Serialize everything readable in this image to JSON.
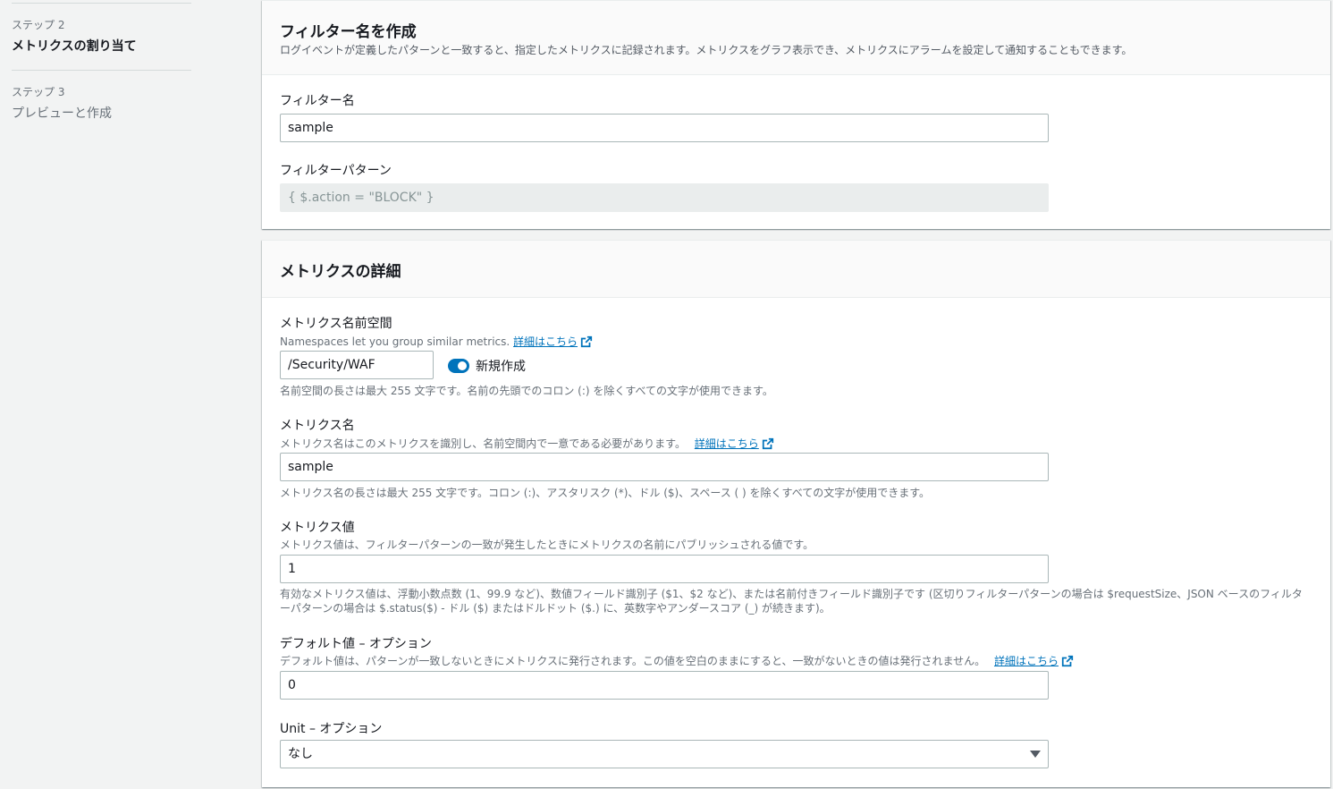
{
  "sidebar": {
    "steps": [
      {
        "label": "ステップ 2",
        "title": "メトリクスの割り当て"
      },
      {
        "label": "ステップ 3",
        "title": "プレビューと作成"
      }
    ]
  },
  "filter_panel": {
    "title": "フィルター名を作成",
    "description": "ログイベントが定義したパターンと一致すると、指定したメトリクスに記録されます。メトリクスをグラフ表示でき、メトリクスにアラームを設定して通知することもできます。",
    "filter_name_label": "フィルター名",
    "filter_name_value": "sample",
    "filter_pattern_label": "フィルターパターン",
    "filter_pattern_value": "{ $.action = \"BLOCK\" }"
  },
  "metric_panel": {
    "title": "メトリクスの詳細",
    "namespace_label": "メトリクス名前空間",
    "namespace_desc": "Namespaces let you group similar metrics.",
    "namespace_value": "/Security/WAF",
    "new_toggle_label": "新規作成",
    "namespace_hint": "名前空間の長さは最大 255 文字です。名前の先頭でのコロン (:) を除くすべての文字が使用できます。",
    "metric_name_label": "メトリクス名",
    "metric_name_desc": "メトリクス名はこのメトリクスを識別し、名前空間内で一意である必要があります。",
    "metric_name_value": "sample",
    "metric_name_hint": "メトリクス名の長さは最大 255 文字です。コロン (:)、アスタリスク (*)、ドル ($)、スペース ( ) を除くすべての文字が使用できます。",
    "metric_value_label": "メトリクス値",
    "metric_value_desc": "メトリクス値は、フィルターパターンの一致が発生したときにメトリクスの名前にパブリッシュされる値です。",
    "metric_value_value": "1",
    "metric_value_hint": "有効なメトリクス値は、浮動小数点数 (1、99.9 など)、数値フィールド識別子 ($1、$2 など)、または名前付きフィールド識別子です (区切りフィルターパターンの場合は $requestSize、JSON ベースのフィルターパターンの場合は $.status($) - ドル ($) またはドルドット ($.) に、英数字やアンダースコア (_) が続きます)。",
    "default_label": "デフォルト値 – オプション",
    "default_desc": "デフォルト値は、パターンが一致しないときにメトリクスに発行されます。この値を空白のままにすると、一致がないときの値は発行されません。",
    "default_value": "0",
    "unit_label": "Unit – オプション",
    "unit_value": "なし",
    "learn_more": "詳細はこちら"
  },
  "colors": {
    "link": "#0073bb",
    "toggle_on": "#0073bb"
  }
}
